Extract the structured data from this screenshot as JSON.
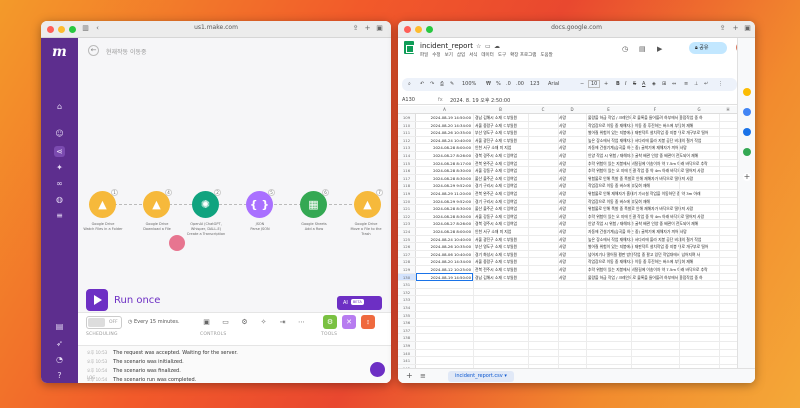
{
  "left_window": {
    "url": "us1.make.com",
    "scenario_name": "현재작동 이동중",
    "run_once_label": "Run once",
    "ai_label": "AI",
    "ai_badge": "BETA",
    "toggle_label": "OFF",
    "schedule_text": "Every 15 minutes.",
    "section_labels": {
      "scheduling": "SCHEDULING",
      "controls": "CONTROLS",
      "tools": "TOOLS"
    },
    "log_label": "LOG",
    "log": [
      {
        "time": "오후 10:53",
        "text": "The request was accepted. Waiting for the server."
      },
      {
        "time": "오후 10:53",
        "text": "The scenario was initialized."
      },
      {
        "time": "오후 10:54",
        "text": "The scenario was finalized."
      },
      {
        "time": "오후 10:54",
        "text": "The scenario run was completed."
      }
    ],
    "modules": [
      {
        "app": "Google Drive",
        "sub": "Watch Files in a Folder",
        "badge": "1",
        "color": "#f6b93b"
      },
      {
        "app": "Google Drive",
        "sub": "Download a File",
        "badge": "4",
        "color": "#f6b93b"
      },
      {
        "app": "OpenAI (ChatGPT, Whisper, DALL-E)",
        "sub": "Create a Transcription",
        "badge": "2",
        "color": "#10a37f"
      },
      {
        "app": "JSON",
        "sub": "Parse JSON",
        "badge": "5",
        "color": "#a970ff"
      },
      {
        "app": "Google Sheets",
        "sub": "Add a Row",
        "badge": "6",
        "color": "#34a853"
      },
      {
        "app": "Google Drive",
        "sub": "Move a File to the Trash",
        "badge": "7",
        "color": "#f6b93b"
      }
    ],
    "sidebar_icons": [
      "home-icon",
      "team-icon",
      "share-icon",
      "puzzle-icon",
      "link-icon",
      "globe-icon",
      "database-icon",
      "book-icon",
      "rocket-icon",
      "bell-icon",
      "help-icon"
    ]
  },
  "right_window": {
    "url": "docs.google.com",
    "doc_title": "incident_report",
    "menus": [
      "파일",
      "수정",
      "보기",
      "삽입",
      "서식",
      "데이터",
      "도구",
      "확장 프로그램",
      "도움말"
    ],
    "share_label": "공유",
    "zoom": "100%",
    "font": "Arial",
    "font_size": "10",
    "cell_ref": "A130",
    "formula_value": "2024. 8. 19 오후 2:50:00",
    "sheet_tab": "incident_report.csv",
    "columns": [
      "A",
      "B",
      "C",
      "D",
      "E",
      "F",
      "G",
      "H"
    ],
    "rows": [
      {
        "n": "109",
        "a": "2024-08-19 14:50:00",
        "b": "경남 김해시 소재 ㄷ부일원",
        "d": "사망",
        "e": "물량을 하급 작업 / 크레인으로 물록을 들어올려 하부에서 용접작업 중 하"
      },
      {
        "n": "110",
        "a": "2024-08-20 14:34:00",
        "b": "서울 중랑구 소재 ㄷ부일원",
        "d": "사망",
        "e": "작업장으로 이동 중 재해자가 이동 중 후진하는 버스에 부딪혀 재해"
      },
      {
        "n": "111",
        "a": "2024-08-26 10:35:00",
        "b": "부산 영도구 소재 ㄷ부일원",
        "d": "사망",
        "e": "벌어질 위험이 있는 지붕에서 재판덕트 설치작업 중 지붕 위로 개구부로 떨어"
      },
      {
        "n": "112",
        "a": "2024-08-24 10:40:00",
        "b": "서울 광진구 소재 ㄷ부일원",
        "d": "사망",
        "e": "높은 장소에서 작업 재해자가 서다리에 올라 지붕 공단 비계의 철거 작업"
      },
      {
        "n": "113",
        "a": "2024-08-28 8:00:00",
        "b": "인천 서구 소재 미 지업",
        "d": "사망",
        "e": "자동에 건설기계(습곡을 하는 중) 굴착기에 재해자가 끼어 사망"
      },
      {
        "n": "114",
        "a": "2024-08-27 8:26:00",
        "b": "경북 경주시 소재 ㄷ잉여업",
        "d": "사망",
        "e": "인양 작업 시 위험 / 재해자가 굴착 배관 인양 중 배관이 전도되어 재해"
      },
      {
        "n": "115",
        "a": "2024-08-28 8:17:00",
        "b": "전북 완주군 소재 ㄷ잉여업",
        "d": "사망",
        "e": "추락 위험이 있는 지붕에서 비탈길에 이송이차 약 7.5m 아래 바닥으로 추락"
      },
      {
        "n": "116",
        "a": "2024-08-28 8:30:00",
        "b": "서울 강동구 소재 ㄷ잉여업",
        "d": "사망",
        "e": "추락 위험이 있는 오 지에 연결 작업 중 약 4m 아래 바닥으로 떨어져 사망"
      },
      {
        "n": "117",
        "a": "2024-08-28 8:30:00",
        "b": "울산 울주군 소재 ㄷ잉여업",
        "d": "사망",
        "e": "위험물로 인해 폭발 중 폭발로 인해 재해자가 바닥으로 떨어져 사망"
      },
      {
        "n": "118",
        "a": "2024-08-29 9:52:00",
        "b": "경기 구리시 소재 ㄷ잉여업",
        "d": "사망",
        "e": "작업장으로 이동 중 버스에 부딪혀 재해"
      },
      {
        "n": "119",
        "a": "2024-08-29 11:20:00",
        "b": "전북 완주군 소재 ㄷ잉여업",
        "d": "사망",
        "e": "위험물로 인해 재해자가 흡배기 가시설 작업을 이동하던 중 약 3m 아래"
      },
      {
        "n": "120",
        "a": "2024-08-29 9:52:00",
        "b": "경기 구리시 소재 ㄷ잉여업",
        "d": "사망",
        "e": "작업장으로 이동 중 버스에 부딪혀 재해"
      },
      {
        "n": "121",
        "a": "2024-08-28 8:30:00",
        "b": "울산 울주군 소재 ㄷ잉여업",
        "d": "사망",
        "e": "위험물로 인해 폭발 중 폭발로 인해 재해자가 바닥으로 떨어져 사망"
      },
      {
        "n": "122",
        "a": "2024-08-28 8:30:00",
        "b": "서울 강동구 소재 ㄷ잉여업",
        "d": "사망",
        "e": "추락 위험이 있는 오 지에 연결 작업 중 약 4m 아래 바닥으로 떨어져 사망"
      },
      {
        "n": "123",
        "a": "2024-08-27 8:26:00",
        "b": "경북 경주시 소재 ㄷ잉여업",
        "d": "사망",
        "e": "인양 작업 시 위험 / 재해자가 굴착 배관 인양 중 배관이 전도되어 재해"
      },
      {
        "n": "124",
        "a": "2024-08-28 8:00:00",
        "b": "인천 서구 소재 미 지업",
        "d": "사망",
        "e": "자동에 건설기계(습곡을 하는 중) 굴착기에 재해자가 끼어 사망"
      },
      {
        "n": "125",
        "a": "2024-08-24 10:40:00",
        "b": "서울 광진구 소재 ㄷ부일원",
        "d": "사망",
        "e": "높은 장소에서 작업 재해자가 서다리에 올라 지붕 공단 비계의 철거 작업"
      },
      {
        "n": "126",
        "a": "2024-08-26 10:35:00",
        "b": "부산 영도구 소재 ㄷ부일원",
        "d": "사망",
        "e": "벌어질 위험이 있는 지붕에서 재판덕트 설치작업 중 지붕 위로 개구부로 떨어"
      },
      {
        "n": "127",
        "a": "2024-08-06 10:40:00",
        "b": "경기 화성시 소재 ㄷ부일원",
        "d": "사망",
        "e": "넘어지기나 떨어질 평판 방향작업 중 팔고 있던 작업대에서 넘어지며 사"
      },
      {
        "n": "128",
        "a": "2024-08-20 14:34:00",
        "b": "서울 중랑구 소재 ㄷ부일원",
        "d": "사망",
        "e": "작업장으로 이동 중 재해자가 이동 중 후진하는 버스에 부딪혀 재해"
      },
      {
        "n": "129",
        "a": "2024-08-12 10:25:00",
        "b": "전북 전주시 소재 ㄷ부일원",
        "d": "사망",
        "e": "추락 위험이 있는 지붕에서 비탈길에 이송이차 약 7.5m 아래 바닥으로 추락"
      },
      {
        "n": "130",
        "a": "2024-08-19 14:50:00",
        "b": "경남 김해시 소재 ㄷ부일원",
        "d": "사망",
        "e": "물량을 하급 작업 / 크레인으로 물록을 들어올려 하부에서 용접작업 중 하"
      }
    ],
    "empty_rows": [
      "131",
      "132",
      "133",
      "134",
      "135",
      "136",
      "137",
      "138",
      "139",
      "140",
      "141",
      "142",
      "143",
      "144"
    ]
  }
}
